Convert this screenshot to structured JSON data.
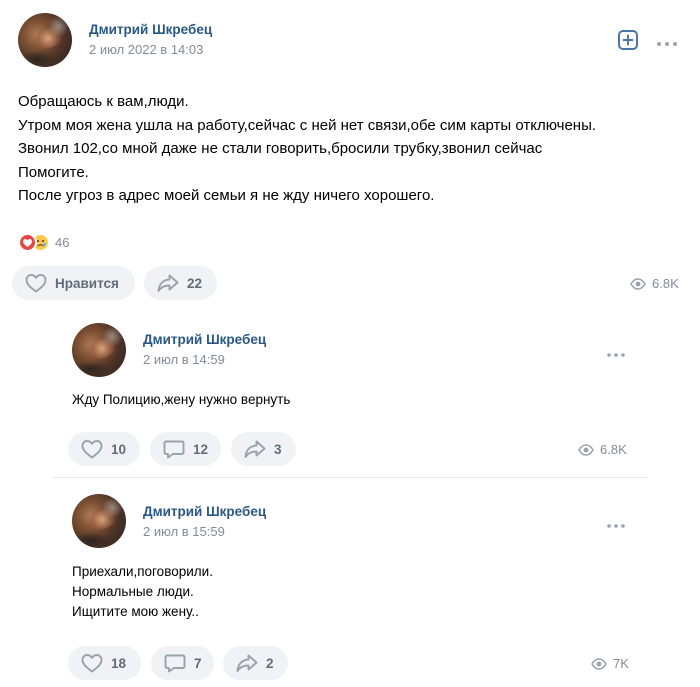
{
  "post": {
    "author": "Дмитрий Шкребец",
    "date": "2 июл 2022 в 14:03",
    "text_lines": [
      "Обращаюсь к вам,люди.",
      "Утром моя жена ушла на работу,сейчас с ней нет связи,обе сим карты отключены.",
      "Звонил 102,со мной даже не стали говорить,бросили трубку,звонил сейчас",
      "Помогите.",
      "После угроз в адрес моей семьи я не жду ничего хорошего."
    ],
    "reactions_count": "46",
    "like_label": "Нравится",
    "share_count": "22",
    "views": "6.8K"
  },
  "replies": [
    {
      "author": "Дмитрий Шкребец",
      "date": "2 июл в 14:59",
      "text_lines": [
        "Жду Полицию,жену нужно вернуть"
      ],
      "likes": "10",
      "comments": "12",
      "shares": "3",
      "views": "6.8K"
    },
    {
      "author": "Дмитрий Шкребец",
      "date": "2 июл в 15:59",
      "text_lines": [
        "Приехали,поговорили.",
        "Нормальные люди.",
        "Ищитите мою жену.."
      ],
      "likes": "18",
      "comments": "7",
      "shares": "2",
      "views": "7K"
    }
  ],
  "icons": {
    "add": "add-square-icon",
    "more": "more-horizontal-icon",
    "like": "heart-outline-icon",
    "comment": "comment-icon",
    "share": "share-arrow-icon",
    "views": "eye-icon"
  },
  "colors": {
    "link": "#2a5885",
    "accent": "#4a76a8",
    "secondary": "#818c99",
    "pill_bg": "#f0f2f5"
  }
}
